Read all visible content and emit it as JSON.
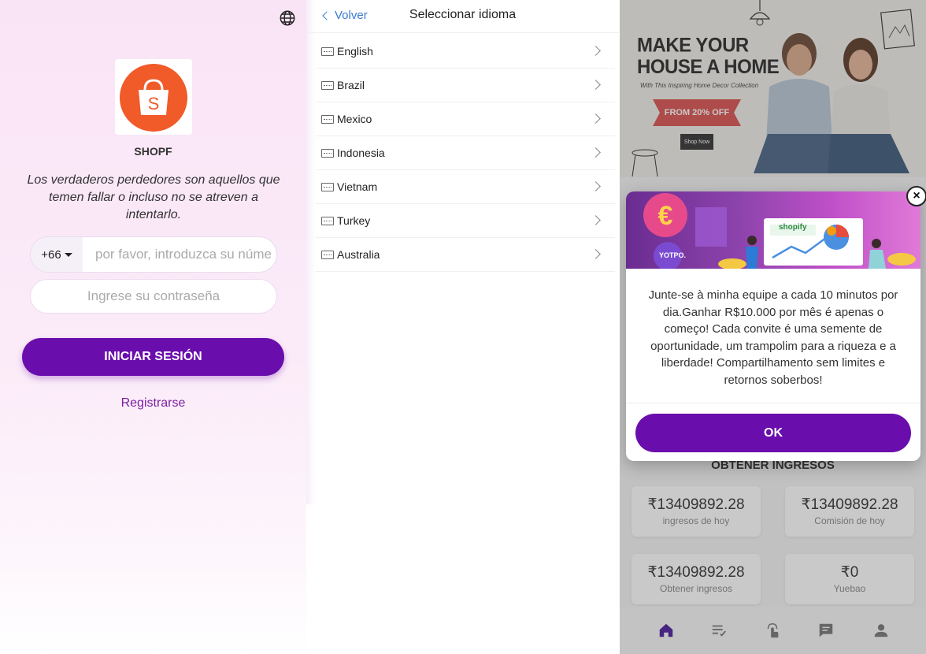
{
  "login": {
    "brand": "SHOPF",
    "quote": "Los verdaderos perdedores son aquellos que temen fallar o incluso no se atreven a intentarlo.",
    "country_code": "+66",
    "phone_placeholder": "por favor, introduzca su número",
    "password_placeholder": "Ingrese su contraseña",
    "login_button": "INICIAR SESIÓN",
    "register_link": "Registrarse",
    "logo_letter": "S",
    "accent_color": "#6a0dad",
    "logo_color": "#f15a29"
  },
  "language": {
    "back_label": "Volver",
    "title": "Seleccionar idioma",
    "items": [
      {
        "label": "English"
      },
      {
        "label": "Brazil"
      },
      {
        "label": "Mexico"
      },
      {
        "label": "Indonesia"
      },
      {
        "label": "Vietnam"
      },
      {
        "label": "Turkey"
      },
      {
        "label": "Australia"
      }
    ]
  },
  "dashboard": {
    "banner": {
      "headline_line1": "MAKE YOUR",
      "headline_line2": "HOUSE A HOME",
      "subline": "With This Inspiring Home Decor Collection",
      "offer": "FROM 20% OFF",
      "shop_now": "Shop Now"
    },
    "earn_title": "OBTENER INGRESOS",
    "cards": [
      {
        "value": "₹13409892.28",
        "label": "ingresos de hoy"
      },
      {
        "value": "₹13409892.28",
        "label": "Comisión de hoy"
      },
      {
        "value": "₹13409892.28",
        "label": "Obtener ingresos"
      },
      {
        "value": "₹0",
        "label": "Yuebao"
      }
    ],
    "modal": {
      "image_text_1": "shopify",
      "image_text_2": "YOTPO.",
      "message": "Junte-se à minha equipe a cada 10 minutos por dia.Ganhar R$10.000 por mês é apenas o começo!  Cada convite é uma semente de oportunidade, um trampolim para a riqueza e a liberdade! Compartilhamento sem limites e retornos soberbos!",
      "ok_button": "OK",
      "close_symbol": "×"
    },
    "tabs": [
      "home-icon",
      "list-icon",
      "touch-icon",
      "chat-icon",
      "user-icon"
    ]
  }
}
